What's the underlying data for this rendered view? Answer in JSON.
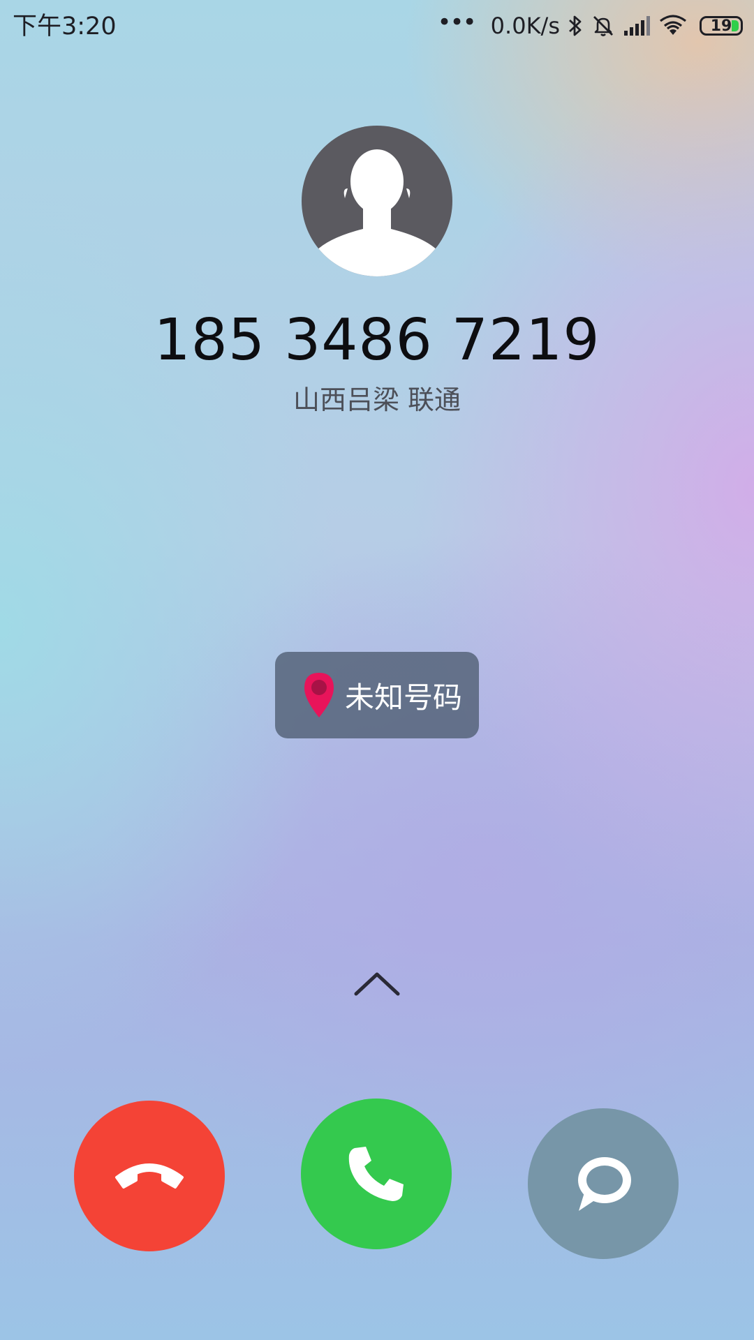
{
  "status_bar": {
    "time": "下午3:20",
    "more_indicator": "•••",
    "net_speed": "0.0K/s",
    "icons": [
      "bluetooth-icon",
      "silent-vibrate-off-icon",
      "signal-icon",
      "wifi-icon"
    ],
    "battery_level": "19",
    "battery_color": "#2fcf4a"
  },
  "caller": {
    "avatar_icon": "default-person-icon",
    "number": "185 3486 7219",
    "location": "山西吕梁 联通"
  },
  "tag": {
    "icon": "location-pin-icon",
    "label": "未知号码",
    "pin_color": "#e8145a"
  },
  "controls": {
    "swipe_hint_icon": "chevron-up-icon",
    "decline": {
      "icon": "phone-hangup-icon",
      "color": "#f44336"
    },
    "accept": {
      "icon": "phone-icon",
      "color": "#34c94e"
    },
    "message": {
      "icon": "chat-bubble-icon",
      "color": "#7796a8"
    }
  }
}
